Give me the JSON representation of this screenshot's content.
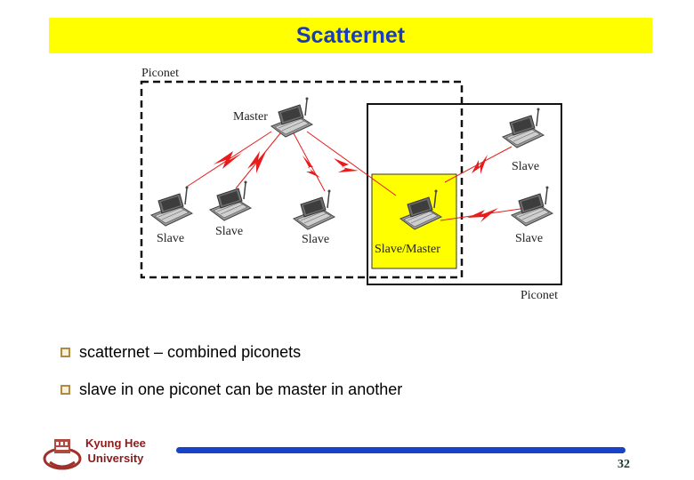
{
  "slide": {
    "title": "Scatternet",
    "diagram": {
      "piconet_label_left": "Piconet",
      "piconet_label_right": "Piconet",
      "devices": {
        "master": "Master",
        "slave_1": "Slave",
        "slave_2": "Slave",
        "slave_3": "Slave",
        "slave_master": "Slave/Master",
        "slave_right_top": "Slave",
        "slave_right_bottom": "Slave"
      },
      "colors": {
        "highlight": "#ffff00",
        "link": "#e81c1c"
      }
    },
    "bullets": [
      {
        "text": "scatternet – combined piconets"
      },
      {
        "text": "slave in one piconet can be master in another"
      }
    ]
  },
  "footer": {
    "university_line1": "Kyung Hee",
    "university_line2": "University",
    "page_number": "32",
    "accent_color": "#1843c8"
  }
}
